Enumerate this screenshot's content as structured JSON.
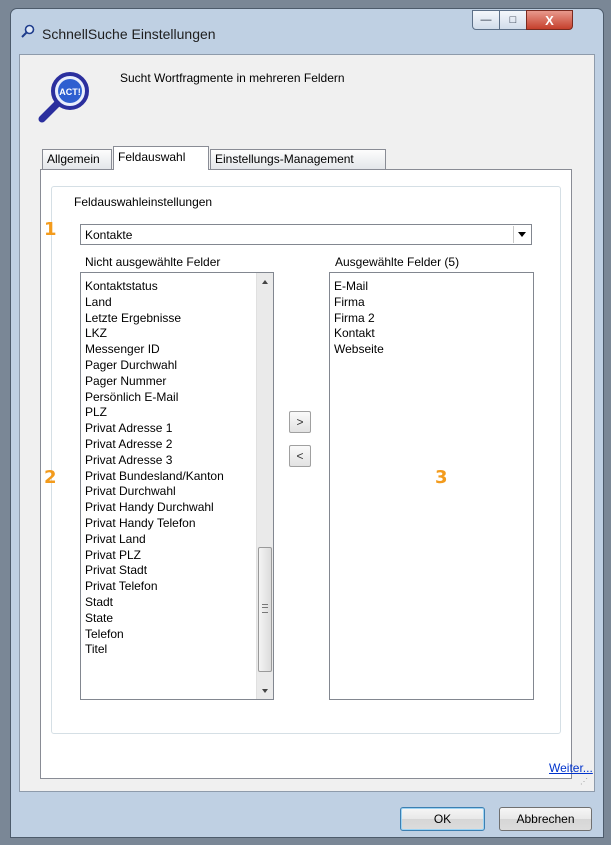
{
  "window": {
    "title": "SchnellSuche Einstellungen",
    "controls": {
      "minimize": "—",
      "maximize": "□",
      "close": "X"
    }
  },
  "header": {
    "description": "Sucht Wortfragmente in mehreren Feldern",
    "logo_text": "ACT!"
  },
  "tabs": [
    {
      "label": "Allgemein",
      "active": false
    },
    {
      "label": "Feldauswahl",
      "active": true
    },
    {
      "label": "Einstellungs-Management",
      "active": false
    }
  ],
  "group": {
    "title": "Feldauswahleinstellungen",
    "combo_value": "Kontakte",
    "left_label": "Nicht ausgewählte Felder",
    "right_label": "Ausgewählte Felder (5)",
    "unselected_fields": [
      "Kontaktstatus",
      "Land",
      "Letzte Ergebnisse",
      "LKZ",
      "Messenger ID",
      "Pager Durchwahl",
      "Pager Nummer",
      "Persönlich E-Mail",
      "PLZ",
      "Privat Adresse 1",
      "Privat Adresse 2",
      "Privat Adresse 3",
      "Privat Bundesland/Kanton",
      "Privat Durchwahl",
      "Privat Handy Durchwahl",
      "Privat Handy Telefon",
      "Privat Land",
      "Privat PLZ",
      "Privat Stadt",
      "Privat Telefon",
      "Stadt",
      "State",
      "Telefon",
      "Titel"
    ],
    "selected_fields": [
      "E-Mail",
      "Firma",
      "Firma 2",
      "Kontakt",
      "Webseite"
    ],
    "add_button": ">",
    "remove_button": "<"
  },
  "markers": {
    "m1": "1",
    "m2": "2",
    "m3": "3"
  },
  "link": {
    "more": "Weiter..."
  },
  "buttons": {
    "ok": "OK",
    "cancel": "Abbrechen"
  },
  "colors": {
    "marker": "#f39b1c",
    "link": "#0033cc",
    "accent": "#3c7fb1"
  }
}
